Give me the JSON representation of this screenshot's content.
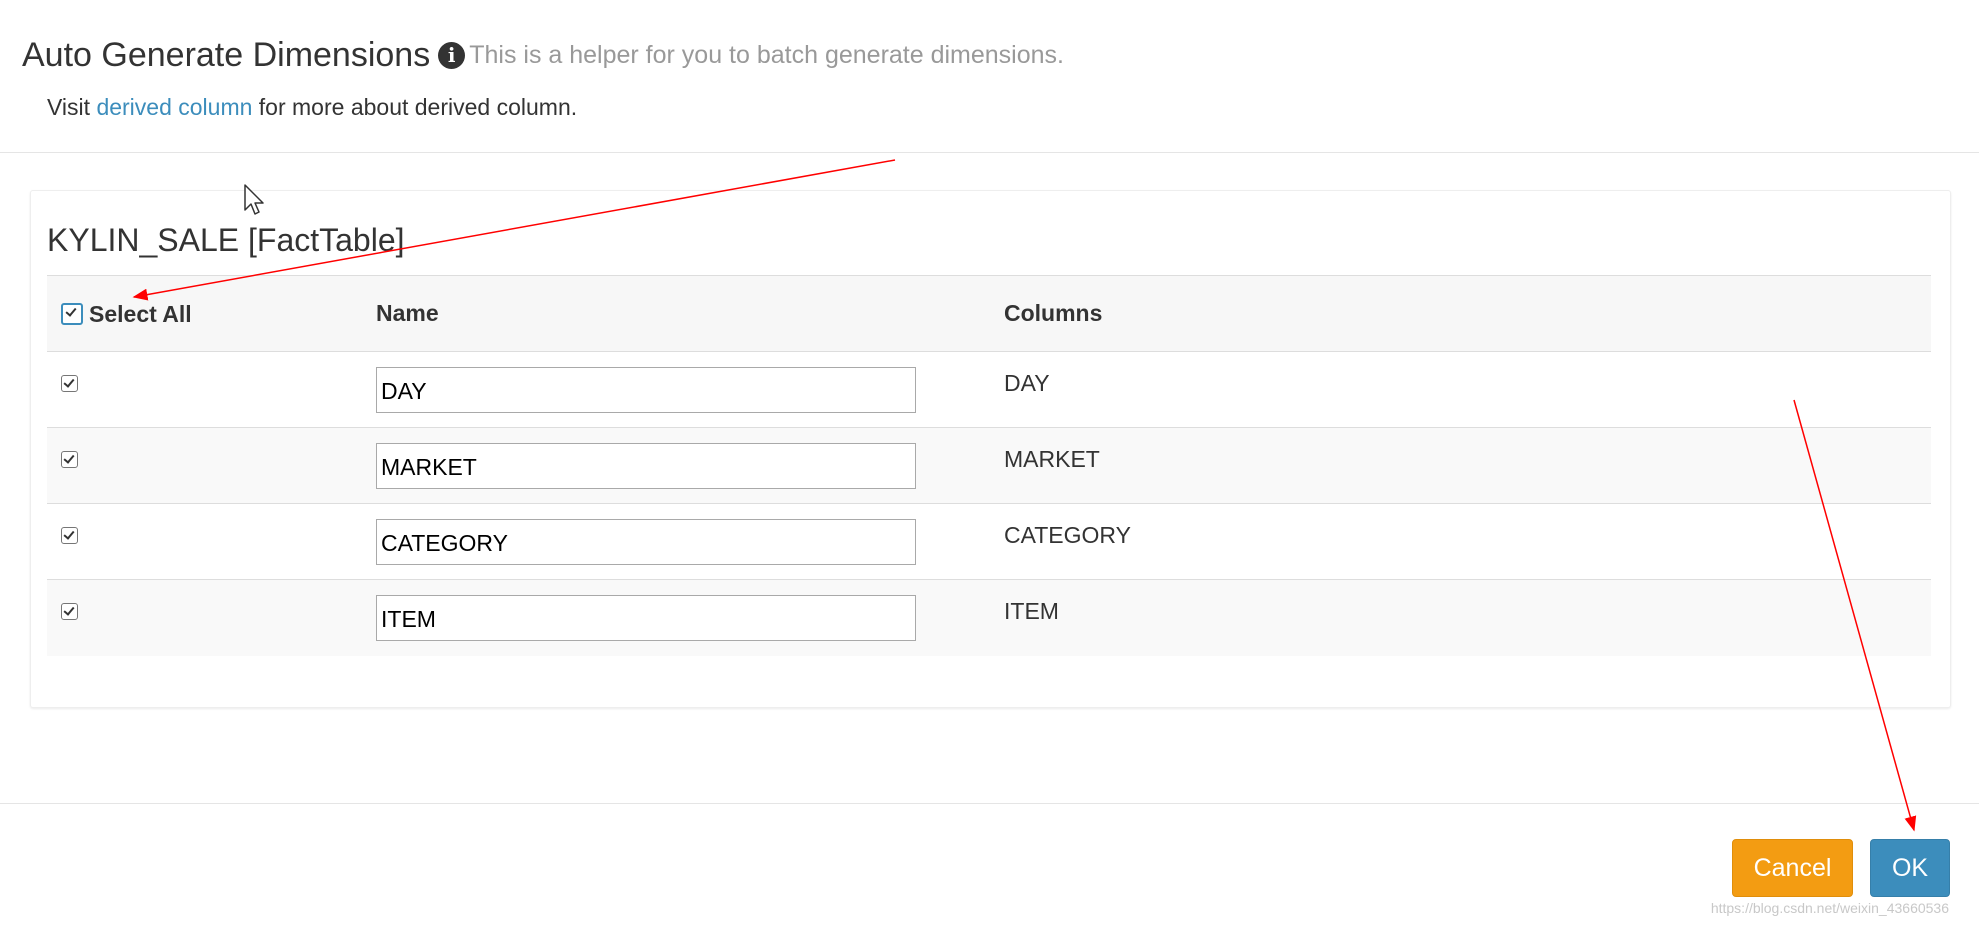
{
  "header": {
    "title": "Auto Generate Dimensions",
    "info_icon_glyph": "i",
    "helper_text": "This is a helper for you to batch generate dimensions.",
    "visit_prefix": "Visit ",
    "visit_link": "derived column",
    "visit_suffix": " for more about derived column."
  },
  "table": {
    "name": "KYLIN_SALE [FactTable]",
    "headers": {
      "select_all": "Select All",
      "name": "Name",
      "columns": "Columns"
    },
    "rows": [
      {
        "checked": true,
        "name": "DAY",
        "column": "DAY"
      },
      {
        "checked": true,
        "name": "MARKET",
        "column": "MARKET"
      },
      {
        "checked": true,
        "name": "CATEGORY",
        "column": "CATEGORY"
      },
      {
        "checked": true,
        "name": "ITEM",
        "column": "ITEM"
      }
    ]
  },
  "footer": {
    "cancel_label": "Cancel",
    "ok_label": "OK"
  },
  "colors": {
    "link": "#3c8dbc",
    "cancel": "#f39c12",
    "ok": "#3c8dbc",
    "annotation_arrow": "#ff0000"
  },
  "watermark": "https://blog.csdn.net/weixin_43660536"
}
